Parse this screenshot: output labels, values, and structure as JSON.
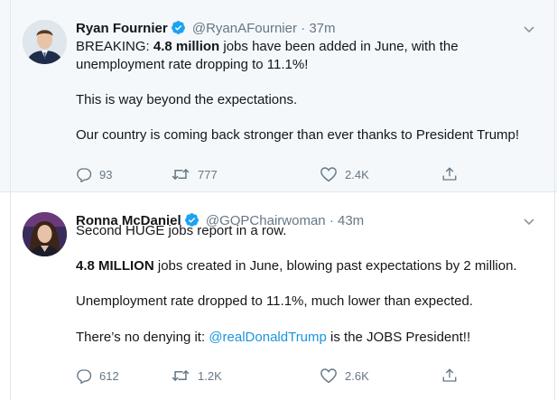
{
  "tweets": [
    {
      "name": "Ryan Fournier",
      "handle": "@RyanAFournier",
      "separator": "·",
      "time": "37m",
      "paragraphs": [
        {
          "prefix": "BREAKING: ",
          "bold": "4.8 million",
          "suffix": " jobs have been added in June, with the unemployment rate dropping to 11.1%!"
        },
        {
          "text": "This is way beyond the expectations."
        },
        {
          "text": "Our country is coming back stronger than ever thanks to President Trump!"
        }
      ],
      "replies": "93",
      "retweets": "777",
      "likes": "2.4K"
    },
    {
      "name": "Ronna McDaniel",
      "handle": "@GOPChairwoman",
      "separator": "·",
      "time": "43m",
      "paragraphs": [
        {
          "text": "Second HUGE jobs report in a row."
        },
        {
          "bold": "4.8 MILLION",
          "suffix": " jobs created in June, blowing past expectations by 2 million."
        },
        {
          "text": "Unemployment rate dropped to 11.1%, much lower than expected."
        },
        {
          "prefix": "There’s no denying it: ",
          "mention": "@realDonaldTrump",
          "suffix": " is the JOBS President!!"
        }
      ],
      "replies": "612",
      "retweets": "1.2K",
      "likes": "2.6K"
    }
  ],
  "colors": {
    "accent": "#1b95e0",
    "verified": "#1da1f2",
    "muted": "#657786",
    "highlight_bg": "#f5f8fa"
  },
  "icons": [
    "verified-badge-icon",
    "chevron-down-icon",
    "reply-icon",
    "retweet-icon",
    "like-icon",
    "share-icon"
  ]
}
